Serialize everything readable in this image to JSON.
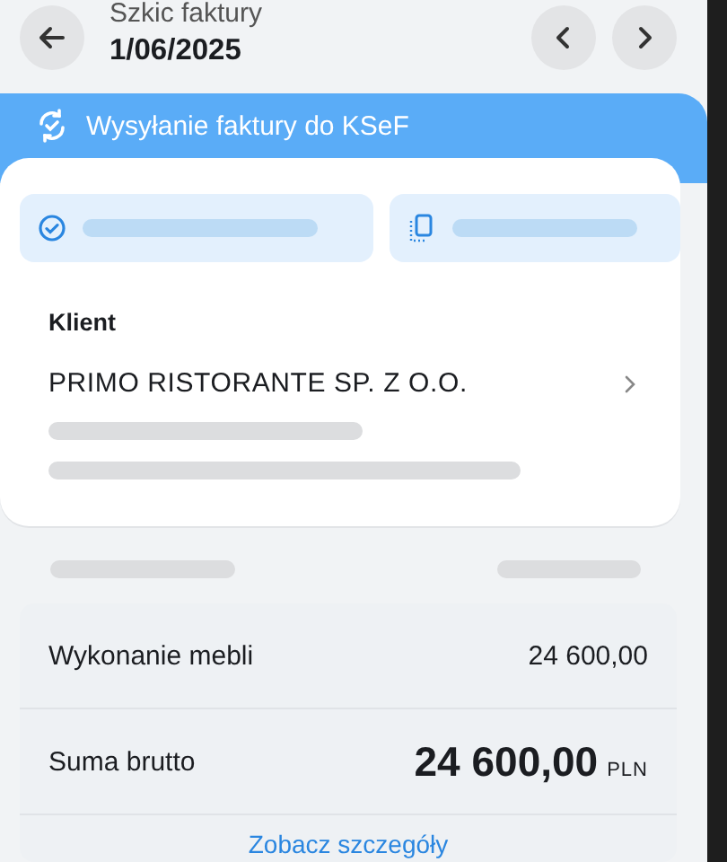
{
  "header": {
    "subtitle": "Szkic faktury",
    "title": "1/06/2025"
  },
  "banner": {
    "text": "Wysyłanie faktury do KSeF"
  },
  "client": {
    "label": "Klient",
    "name": "PRIMO RISTORANTE SP. Z O.O."
  },
  "items": [
    {
      "name": "Wykonanie mebli",
      "amount": "24 600,00"
    }
  ],
  "total": {
    "label": "Suma brutto",
    "amount": "24 600,00",
    "currency": "PLN"
  },
  "details_link": "Zobacz szczegóły"
}
